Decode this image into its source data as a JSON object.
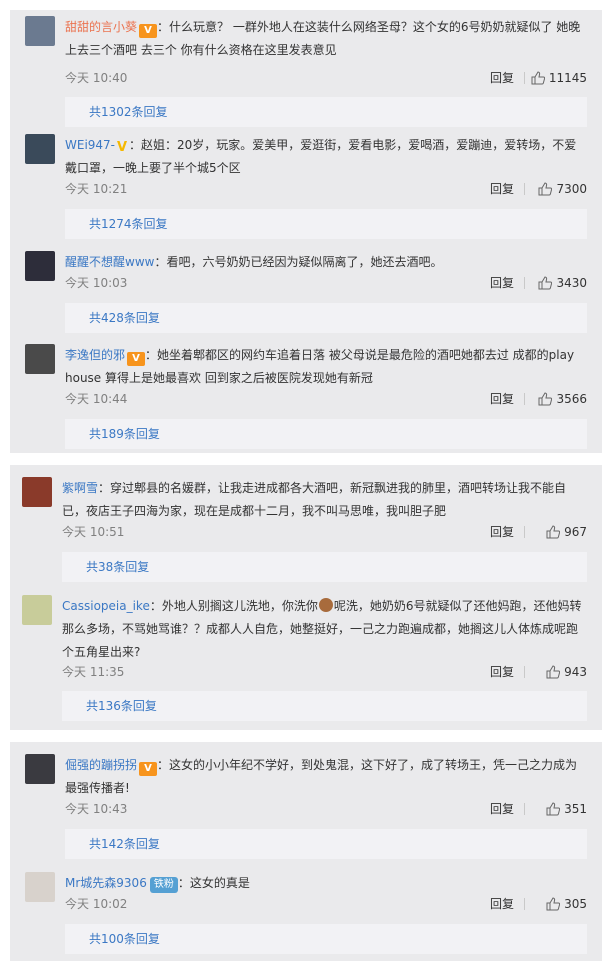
{
  "groups": [
    {
      "comments": [
        {
          "username": "甜甜的言小葵",
          "badge": "vip",
          "badge_text": "V",
          "text": "：什么玩意？ 一群外地人在这装什么网络圣母？这个女的6号奶奶就疑似了 她晚上去三个酒吧 去三个 你有什么资格在这里发表意见",
          "time": "今天 10:40",
          "reply": "回复",
          "likes": "11145",
          "more_replies": "共1302条回复",
          "avatar_color": "#6b7a90"
        },
        {
          "username": "WEi947-",
          "badge": "v",
          "badge_text": "V",
          "text": "：赵姐：20岁，玩家。爱美甲，爱逛街，爱看电影，爱喝酒，爱蹦迪，爱转场，不爱戴口罩，一晚上要了半个城5个区",
          "time": "今天 10:21",
          "reply": "回复",
          "likes": "7300",
          "more_replies": "共1274条回复",
          "avatar_color": "#3a4a5a"
        },
        {
          "username": "醒醒不想醒www",
          "badge": "",
          "badge_text": "",
          "text": "：看吧，六号奶奶已经因为疑似隔离了，她还去酒吧。",
          "time": "今天 10:03",
          "reply": "回复",
          "likes": "3430",
          "more_replies": "共428条回复",
          "avatar_color": "#2d2d3a"
        },
        {
          "username": "李逸但的邪",
          "badge": "vip",
          "badge_text": "V",
          "text": "：她坐着郫都区的网约车追着日落  被父母说是最危险的酒吧她都去过  成都的play house 算得上是她最喜欢  回到家之后被医院发现她有新冠",
          "time": "今天 10:44",
          "reply": "回复",
          "likes": "3566",
          "more_replies": "共189条回复",
          "avatar_color": "#4a4a4a"
        }
      ]
    },
    {
      "comments": [
        {
          "username": "紫啊雪",
          "badge": "",
          "badge_text": "",
          "text": "：穿过郫县的名媛群，让我走进成都各大酒吧，新冠飘进我的肺里，酒吧转场让我不能自已，夜店王子四海为家，现在是成都十二月，我不叫马思唯，我叫胆子肥",
          "time": "今天 10:51",
          "reply": "回复",
          "likes": "967",
          "more_replies": "共38条回复",
          "avatar_color": "#8a3a2a"
        },
        {
          "username": "Cassiopeia_ike",
          "badge": "",
          "badge_text": "",
          "text_before": "：外地人别搁这儿洗地，你洗你",
          "text": "呢洗，她奶奶6号就疑似了还他妈跑，还他妈转那么多场，不骂她骂谁？？成都人人自危，她整挺好，一己之力跑遍成都，她搁这儿人体炼成呢跑个五角星出来?",
          "time": "今天 11:35",
          "reply": "回复",
          "likes": "943",
          "more_replies": "共136条回复",
          "avatar_color": "#c8cc9a"
        }
      ]
    },
    {
      "comments": [
        {
          "username": "倔强的蹦拐拐",
          "badge": "vip",
          "badge_text": "V",
          "text": "：这女的小小年纪不学好，到处鬼混，这下好了，成了转场王，凭一己之力成为最强传播者!",
          "time": "今天 10:43",
          "reply": "回复",
          "likes": "351",
          "more_replies": "共142条回复",
          "avatar_color": "#3a3a40"
        },
        {
          "username": "Mr城先森9306",
          "badge": "fan",
          "badge_text": "铁粉",
          "text": "：这女的真是",
          "time": "今天 10:02",
          "reply": "回复",
          "likes": "305",
          "more_replies": "共100条回复",
          "avatar_color": "#d8d2cc"
        }
      ]
    }
  ]
}
